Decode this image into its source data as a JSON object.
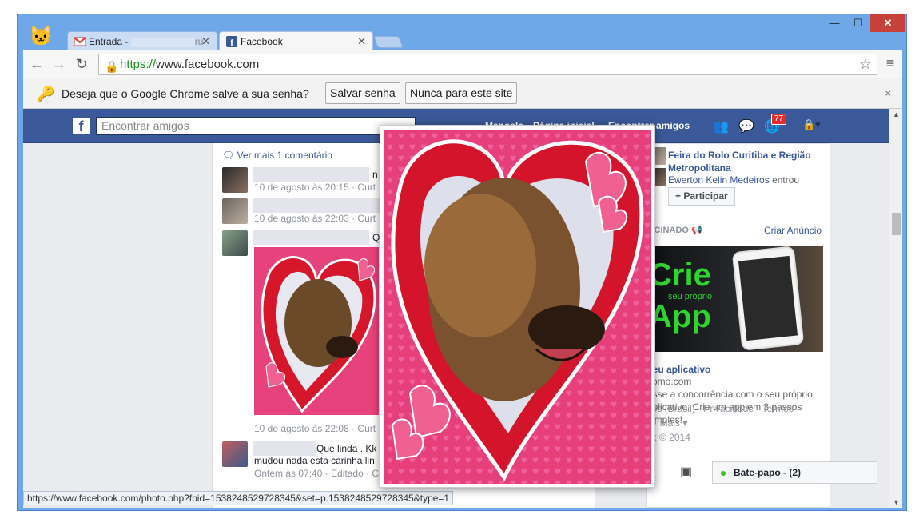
{
  "browser": {
    "tabs": [
      {
        "label": "Entrada - ",
        "label_tail": "ru",
        "icon": "gmail-icon"
      },
      {
        "label": "Facebook",
        "icon": "facebook-icon"
      }
    ],
    "url_scheme": "https://",
    "url_rest": "www.facebook.com",
    "window_controls": {
      "minimize": "—",
      "maximize": "☐",
      "close": "✕"
    }
  },
  "infobar": {
    "question": "Deseja que o Google Chrome salve a sua senha?",
    "save_label": "Salvar senha",
    "never_label": "Nunca para este site",
    "close": "×"
  },
  "fb": {
    "logo": "f",
    "search_placeholder": "Encontrar amigos",
    "nav": [
      "Manoela",
      "Página inicial",
      "Encontrar amigos"
    ],
    "notifications": "77"
  },
  "feed": {
    "more_comments": "Ver mais 1 comentário",
    "comments": [
      {
        "meta": "10 de agosto às 20:15 · Curt",
        "suffix": "n"
      },
      {
        "meta": "10 de agosto às 22:03 · Curt"
      },
      {
        "suffix": "Q"
      },
      {
        "meta": "10 de agosto às 22:08 · Curt"
      },
      {
        "text1": "Que linda . Kk",
        "text2": "mudou nada esta carinha lin",
        "meta": "Ontem às 07:40 · Editado · C"
      }
    ]
  },
  "sidebar": {
    "event_title": "Feira do Rolo Curitiba e Região Metropolitana",
    "event_person": "Ewerton Kelin Medeiros",
    "event_action": "entrou",
    "join_label": "+ Participar",
    "sponsored": "OCINADO",
    "create_ad": "Criar Anúncio",
    "ad_crie": "Crie",
    "ad_seu": "seu próprio",
    "ad_app": "App",
    "ad_title": "seu aplicativo",
    "ad_domain": "como.com",
    "ad_text": "asse a concorrência com o seu próprio aplicativo. Crie um app em 3 passos simples!"
  },
  "footer": {
    "line1": "uês (Brasil) · Privacidade · Termos ·",
    "line2": "s · Mais ▾",
    "line3": "ok © 2014"
  },
  "chat": {
    "label": "Bate-papo - (2)"
  },
  "statusbar": {
    "url": "https://www.facebook.com/photo.php?fbid=1538248529728345&set=p.1538248529728345&type=1"
  }
}
